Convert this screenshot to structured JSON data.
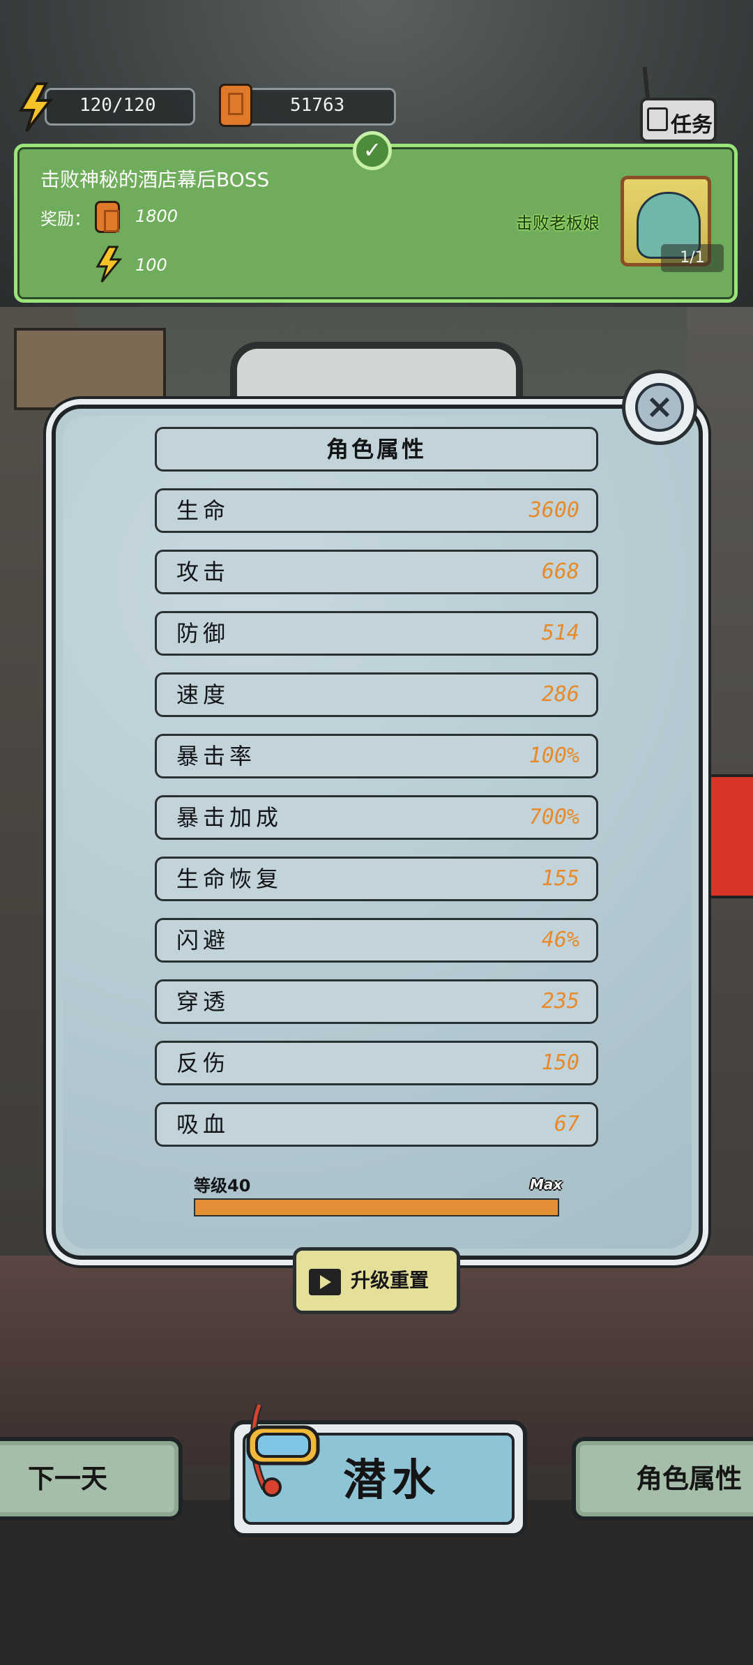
{
  "top_bar": {
    "energy": "120/120",
    "fuel": "51763",
    "quest_button_label": "任务"
  },
  "quest": {
    "title": "击败神秘的酒店幕后BOSS",
    "reward_label": "奖励：",
    "reward_fuel": "1800",
    "reward_energy": "100",
    "target_label": "击败老板娘",
    "progress": "1/1"
  },
  "attributes": {
    "title": "角色属性",
    "rows": [
      {
        "name": "生命",
        "value": "3600"
      },
      {
        "name": "攻击",
        "value": "668"
      },
      {
        "name": "防御",
        "value": "514"
      },
      {
        "name": "速度",
        "value": "286"
      },
      {
        "name": "暴击率",
        "value": "100%"
      },
      {
        "name": "暴击加成",
        "value": "700%"
      },
      {
        "name": "生命恢复",
        "value": "155"
      },
      {
        "name": "闪避",
        "value": "46%"
      },
      {
        "name": "穿透",
        "value": "235"
      },
      {
        "name": "反伤",
        "value": "150"
      },
      {
        "name": "吸血",
        "value": "67"
      }
    ],
    "level_label": "等级40",
    "level_max_label": "Max",
    "level_progress": 1.0,
    "reset_label": "升级重置"
  },
  "bottom": {
    "next_day": "下一天",
    "dive": "潜水",
    "attributes": "角色属性"
  },
  "colors": {
    "quest_green": "#6fad5c",
    "value_orange": "#e8892a",
    "panel_blue": "#b7cbd3"
  }
}
